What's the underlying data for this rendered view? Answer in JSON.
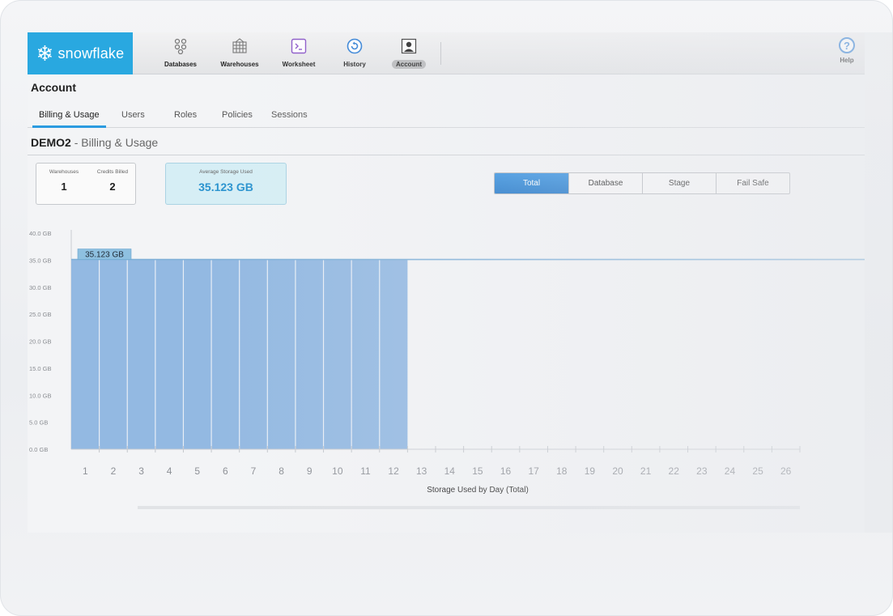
{
  "nav": {
    "logo_text": "snowflake",
    "items": [
      {
        "label": "Databases",
        "icon": "databases-icon"
      },
      {
        "label": "Warehouses",
        "icon": "warehouses-icon"
      },
      {
        "label": "Worksheet",
        "icon": "worksheet-icon"
      },
      {
        "label": "History",
        "icon": "history-icon"
      },
      {
        "label": "Account",
        "icon": "account-icon",
        "active": true
      }
    ],
    "help_label": "Help"
  },
  "page": {
    "title": "Account",
    "tabs": [
      {
        "label": "Billing & Usage",
        "active": true
      },
      {
        "label": "Users"
      },
      {
        "label": "Roles"
      },
      {
        "label": "Policies"
      },
      {
        "label": "Sessions"
      }
    ],
    "account_name": "DEMO2",
    "section": "- Billing & Usage"
  },
  "stats": {
    "warehouses_label": "Warehouses",
    "warehouses_value": "1",
    "credits_label": "Credits Billed",
    "credits_value": "2",
    "storage_label": "Average Storage Used",
    "storage_value": "35.123 GB"
  },
  "filters": {
    "options": [
      "Total",
      "Database",
      "Stage",
      "Fail Safe"
    ],
    "selected": "Total"
  },
  "colors": {
    "accent": "#2b9be0",
    "bar": "#93b9e2",
    "average_line": "#7fb0d8",
    "logo_bg": "#29a8e0"
  },
  "chart_data": {
    "type": "bar",
    "x": [
      1,
      2,
      3,
      4,
      5,
      6,
      7,
      8,
      9,
      10,
      11,
      12,
      13,
      14,
      15,
      16,
      17,
      18,
      19,
      20,
      21,
      22,
      23,
      24,
      25,
      26
    ],
    "values": [
      35.123,
      35.123,
      35.123,
      35.123,
      35.123,
      35.123,
      35.123,
      35.123,
      35.123,
      35.123,
      35.123,
      35.123,
      null,
      null,
      null,
      null,
      null,
      null,
      null,
      null,
      null,
      null,
      null,
      null,
      null,
      null
    ],
    "y_unit": "GB",
    "y_ticks": [
      "0.0 GB",
      "5.0 GB",
      "10.0 GB",
      "15.0 GB",
      "20.0 GB",
      "25.0 GB",
      "30.0 GB",
      "35.0 GB",
      "40.0 GB"
    ],
    "ylim": [
      0,
      40
    ],
    "reference_line": {
      "value": 35.123,
      "label": "35.123 GB"
    },
    "xlabel": "Storage Used by Day (Total)",
    "ylabel": ""
  }
}
